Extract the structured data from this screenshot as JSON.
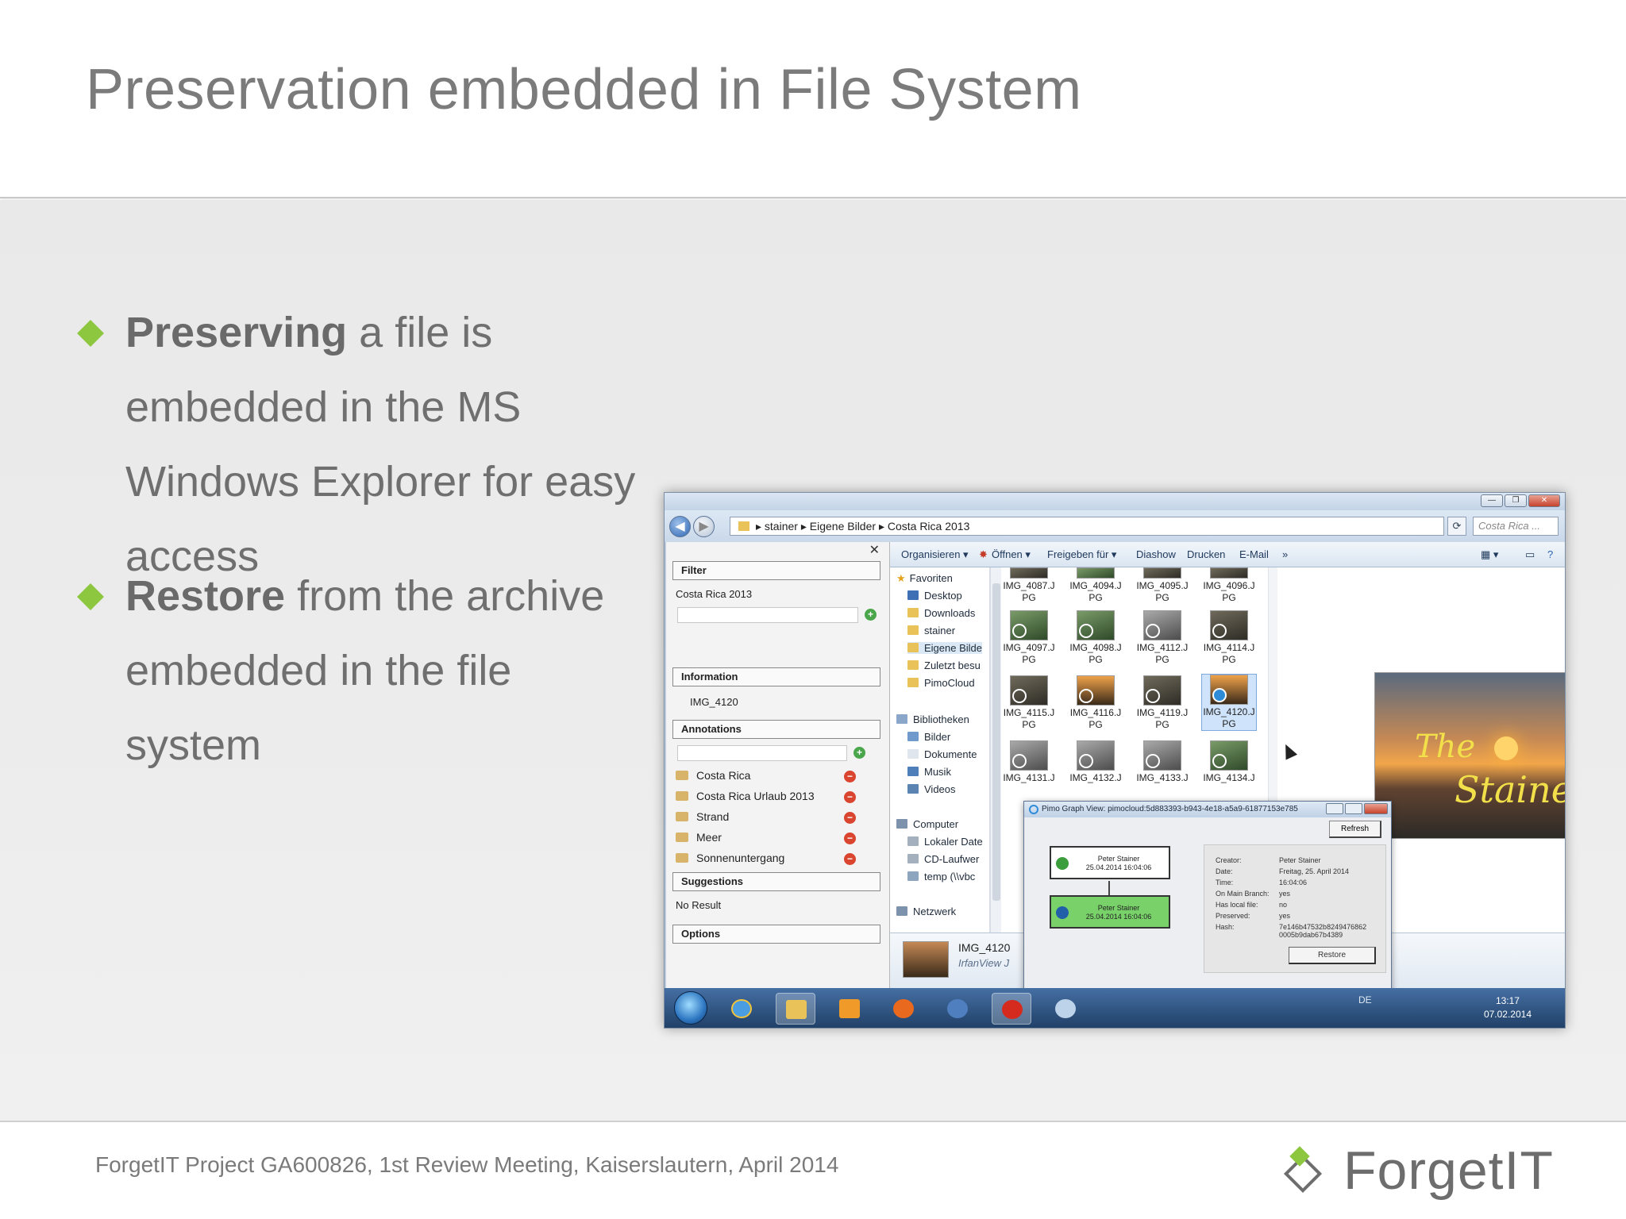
{
  "slide": {
    "title": "Preservation embedded in File System",
    "bullets": [
      {
        "bold": "Preserving",
        "rest": " a file is embedded in the MS Windows Explorer for easy access"
      },
      {
        "bold": "Restore",
        "rest": " from the archive embedded in the file system"
      }
    ],
    "footer": "ForgetIT Project GA600826, 1st Review Meeting, Kaiserslautern, April 2014",
    "logo_text": "ForgetIT",
    "accent_color": "#8dc63f"
  },
  "explorer": {
    "address": {
      "parts": [
        "stainer",
        "Eigene Bilder",
        "Costa Rica 2013"
      ],
      "separator": "▸"
    },
    "search_placeholder": "Costa Rica ...",
    "window_buttons": [
      "—",
      "❐",
      "✕"
    ],
    "commands": [
      "Organisieren ▾",
      "Öffnen ▾",
      "Freigeben für ▾",
      "Diashow",
      "Drucken",
      "E-Mail",
      "»"
    ],
    "pimo": {
      "close": "✕",
      "filter_label": "Filter",
      "filter_value": "Costa Rica 2013",
      "information_label": "Information",
      "information_value": "IMG_4120",
      "annotations_label": "Annotations",
      "annotations": [
        "Costa Rica",
        "Costa Rica Urlaub 2013",
        "Strand",
        "Meer",
        "Sonnenuntergang"
      ],
      "suggestions_label": "Suggestions",
      "suggestions_value": "No Result",
      "options_label": "Options"
    },
    "nav": {
      "favorites": "Favoriten",
      "items": [
        "Desktop",
        "Downloads",
        "stainer",
        "Eigene Bilde",
        "Zuletzt besu",
        "PimoCloud"
      ],
      "libraries": "Bibliotheken",
      "lib_items": [
        "Bilder",
        "Dokumente",
        "Musik",
        "Videos"
      ],
      "computer": "Computer",
      "computer_items": [
        "Lokaler Date",
        "CD-Laufwer",
        "temp (\\\\vbc"
      ],
      "network": "Netzwerk"
    },
    "files": [
      {
        "l1": "IMG_4087.J",
        "l2": "PG"
      },
      {
        "l1": "IMG_4094.J",
        "l2": "PG"
      },
      {
        "l1": "IMG_4095.J",
        "l2": "PG"
      },
      {
        "l1": "IMG_4096.J",
        "l2": "PG"
      },
      {
        "l1": "IMG_4097.J",
        "l2": "PG"
      },
      {
        "l1": "IMG_4098.J",
        "l2": "PG"
      },
      {
        "l1": "IMG_4112.J",
        "l2": "PG"
      },
      {
        "l1": "IMG_4114.J",
        "l2": "PG"
      },
      {
        "l1": "IMG_4115.J",
        "l2": "PG"
      },
      {
        "l1": "IMG_4116.J",
        "l2": "PG"
      },
      {
        "l1": "IMG_4119.J",
        "l2": "PG"
      },
      {
        "l1": "IMG_4120.J",
        "l2": "PG"
      },
      {
        "l1": "IMG_4131.J",
        "l2": ""
      },
      {
        "l1": "IMG_4132.J",
        "l2": ""
      },
      {
        "l1": "IMG_4133.J",
        "l2": ""
      },
      {
        "l1": "IMG_4134.J",
        "l2": ""
      }
    ],
    "preview_text": [
      "The",
      "Stainers"
    ],
    "details": {
      "name": "IMG_4120",
      "app": "IrfanView J"
    },
    "dialog": {
      "title": "Pimo Graph View: pimocloud:5d883393-b943-4e18-a5a9-61877153e785",
      "refresh": "Refresh",
      "node1": {
        "name": "Peter Stainer",
        "date": "25.04.2014 16:04:06"
      },
      "node2": {
        "name": "Peter Stainer",
        "date": "25.04.2014 16:04:06"
      },
      "info": [
        {
          "k": "Creator:",
          "v": "Peter Stainer"
        },
        {
          "k": "Date:",
          "v": "Freitag, 25. April 2014"
        },
        {
          "k": "Time:",
          "v": "16:04:06"
        },
        {
          "k": "On Main Branch:",
          "v": "yes"
        },
        {
          "k": "Has local file:",
          "v": "no"
        },
        {
          "k": "Preserved:",
          "v": "yes"
        },
        {
          "k": "Hash:",
          "v": "7e146b47532b8249476862 0005b9dab67b4389"
        }
      ],
      "restore": "Restore"
    },
    "taskbar": {
      "lang": "DE",
      "time": "13:17",
      "date": "07.02.2014"
    }
  }
}
